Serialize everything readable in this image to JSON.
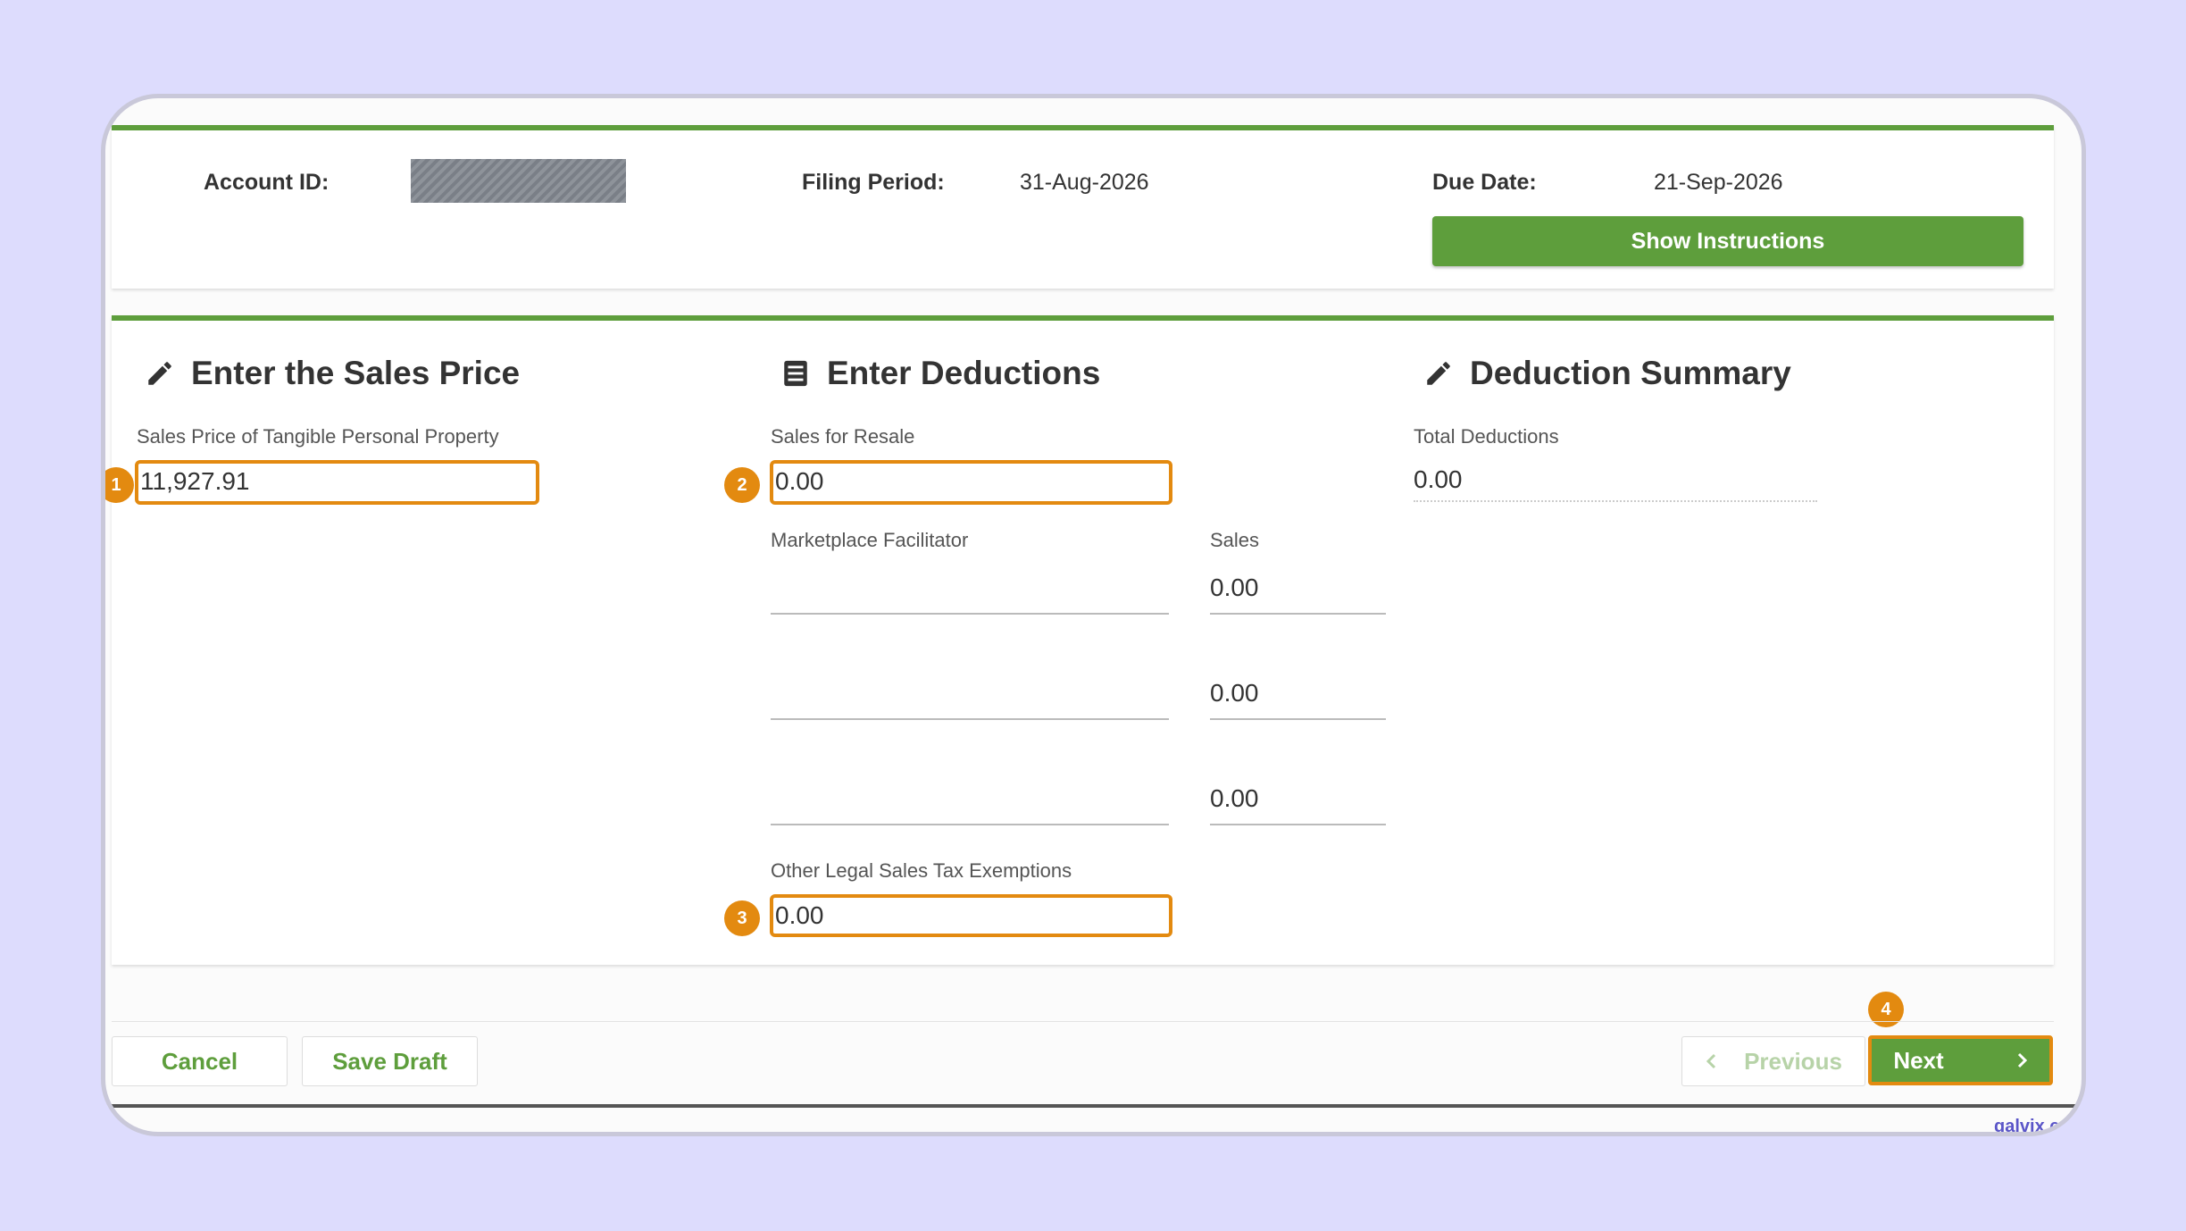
{
  "header": {
    "account_label": "Account ID:",
    "filing_label": "Filing Period:",
    "filing_value": "31-Aug-2026",
    "due_label": "Due Date:",
    "due_value": "21-Sep-2026",
    "instructions_button": "Show Instructions"
  },
  "sales_price": {
    "title": "Enter the Sales Price",
    "field_label": "Sales Price of Tangible Personal Property",
    "field_value": "11,927.91"
  },
  "deductions": {
    "title": "Enter Deductions",
    "resale_label": "Sales for Resale",
    "resale_value": "0.00",
    "facilitator_label": "Marketplace Facilitator",
    "sales_label": "Sales",
    "facilitator_rows": [
      {
        "name": "",
        "sales": "0.00"
      },
      {
        "name": "",
        "sales": "0.00"
      },
      {
        "name": "",
        "sales": "0.00"
      }
    ],
    "other_label": "Other Legal Sales Tax Exemptions",
    "other_value": "0.00"
  },
  "summary": {
    "title": "Deduction Summary",
    "total_label": "Total Deductions",
    "total_value": "0.00"
  },
  "badges": [
    "1",
    "2",
    "3",
    "4"
  ],
  "footer": {
    "cancel": "Cancel",
    "save_draft": "Save Draft",
    "previous": "Previous",
    "next": "Next"
  },
  "watermark": "galvix.co",
  "colors": {
    "accent_green": "#5e9e3c",
    "highlight_orange": "#e38a10",
    "background": "#dddcfd"
  },
  "icons": [
    "pencil-icon",
    "list-icon",
    "chevron-left-icon",
    "chevron-right-icon"
  ]
}
